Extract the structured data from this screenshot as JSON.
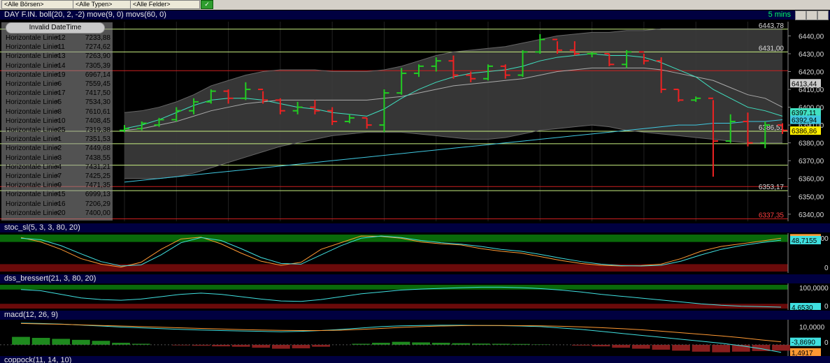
{
  "toolbar": {
    "combo1": "<Alle Börsen>",
    "combo2": "<Alle Typen>",
    "combo3": "<Alle Felder>",
    "go": "✓"
  },
  "main_header": {
    "title": "DAY F.IN. boll(20, 2, -2) move(9, 0) movs(60, 0)",
    "timeframe": "5 mins"
  },
  "legend": {
    "invalid": "Invalid DateTime",
    "rows": [
      {
        "name": "Horizontale Linie12",
        "value": "7233,88"
      },
      {
        "name": "Horizontale Linie11",
        "value": "7274,62"
      },
      {
        "name": "Horizontale Linie13",
        "value": "7263,90"
      },
      {
        "name": "Horizontale Linie14",
        "value": "7305,39"
      },
      {
        "name": "Horizontale Linie19",
        "value": "6967,14"
      },
      {
        "name": "Horizontale Linie6",
        "value": "7559,45"
      },
      {
        "name": "Horizontale Linie17",
        "value": "7417,50"
      },
      {
        "name": "Horizontale Linie5",
        "value": "7534,30"
      },
      {
        "name": "Horizontale Linie8",
        "value": "7610,61"
      },
      {
        "name": "Horizontale Linie10",
        "value": "7408,45"
      },
      {
        "name": "Horizontale Linie25",
        "value": "7319,38"
      },
      {
        "name": "Horizontale Linie1",
        "value": "7351,53"
      },
      {
        "name": "Horizontale Linie2",
        "value": "7449,68"
      },
      {
        "name": "Horizontale Linie3",
        "value": "7438,55"
      },
      {
        "name": "Horizontale Linie4",
        "value": "7431,21"
      },
      {
        "name": "Horizontale Linie7",
        "value": "7425,25"
      },
      {
        "name": "Horizontale Linie9",
        "value": "7471,35"
      },
      {
        "name": "Horizontale Linie15",
        "value": "6999,13"
      },
      {
        "name": "Horizontale Linie16",
        "value": "7206,29"
      },
      {
        "name": "Horizontale Linie20",
        "value": "7400,00"
      }
    ]
  },
  "panels": {
    "stoc": {
      "title": "stoc_sl(5, 3, 3, 80, 20)"
    },
    "dss": {
      "title": "dss_bressert(21, 3, 80, 20)"
    },
    "macd": {
      "title": "macd(12, 26, 9)"
    },
    "coppock": {
      "title": "coppock(11, 14, 10)"
    }
  },
  "chart_data": [
    {
      "type": "bar",
      "title": "DAY F.IN. boll(20, 2, -2) move(9, 0) movs(60, 0)",
      "ylim": [
        6336,
        6448
      ],
      "y_ticks": [
        6340,
        6350,
        6360,
        6370,
        6380,
        6390,
        6400,
        6410,
        6420,
        6430,
        6440
      ],
      "y_tick_labels": [
        "6340,00",
        "6350,00",
        "6360,00",
        "6370,00",
        "6380,00",
        "6390,00",
        "6400,00",
        "6410,00",
        "6420,00",
        "6430,00",
        "6440,00"
      ],
      "colors": {
        "up": "#22cc22",
        "down": "#ee2222",
        "ma_fast": "#40e0c0",
        "ma_slow": "#aaaaaa",
        "ma_long": "#40c8e0",
        "band": "#3c3c3c",
        "hline": "#c8f080",
        "hline_red": "#cc2020"
      },
      "ohlc": [
        {
          "o": 6387,
          "h": 6390,
          "l": 6386,
          "c": 6388
        },
        {
          "o": 6388,
          "h": 6392,
          "l": 6387,
          "c": 6391
        },
        {
          "o": 6390,
          "h": 6394,
          "l": 6389,
          "c": 6393
        },
        {
          "o": 6393,
          "h": 6400,
          "l": 6392,
          "c": 6398
        },
        {
          "o": 6398,
          "h": 6405,
          "l": 6396,
          "c": 6403
        },
        {
          "o": 6403,
          "h": 6410,
          "l": 6402,
          "c": 6409
        },
        {
          "o": 6409,
          "h": 6410,
          "l": 6402,
          "c": 6405
        },
        {
          "o": 6405,
          "h": 6414,
          "l": 6404,
          "c": 6410
        },
        {
          "o": 6410,
          "h": 6409,
          "l": 6402,
          "c": 6404
        },
        {
          "o": 6404,
          "h": 6405,
          "l": 6396,
          "c": 6398
        },
        {
          "o": 6398,
          "h": 6403,
          "l": 6396,
          "c": 6400
        },
        {
          "o": 6400,
          "h": 6404,
          "l": 6396,
          "c": 6398
        },
        {
          "o": 6398,
          "h": 6400,
          "l": 6390,
          "c": 6392
        },
        {
          "o": 6392,
          "h": 6396,
          "l": 6391,
          "c": 6394
        },
        {
          "o": 6394,
          "h": 6394,
          "l": 6388,
          "c": 6390
        },
        {
          "o": 6390,
          "h": 6410,
          "l": 6386,
          "c": 6408
        },
        {
          "o": 6408,
          "h": 6422,
          "l": 6407,
          "c": 6419
        },
        {
          "o": 6419,
          "h": 6424,
          "l": 6417,
          "c": 6423
        },
        {
          "o": 6423,
          "h": 6428,
          "l": 6420,
          "c": 6426
        },
        {
          "o": 6426,
          "h": 6429,
          "l": 6416,
          "c": 6418
        },
        {
          "o": 6418,
          "h": 6420,
          "l": 6414,
          "c": 6416
        },
        {
          "o": 6416,
          "h": 6424,
          "l": 6415,
          "c": 6423
        },
        {
          "o": 6423,
          "h": 6424,
          "l": 6416,
          "c": 6418
        },
        {
          "o": 6418,
          "h": 6432,
          "l": 6417,
          "c": 6431
        },
        {
          "o": 6431,
          "h": 6441,
          "l": 6430,
          "c": 6438
        },
        {
          "o": 6438,
          "h": 6437,
          "l": 6430,
          "c": 6432
        },
        {
          "o": 6432,
          "h": 6437,
          "l": 6429,
          "c": 6430
        },
        {
          "o": 6430,
          "h": 6431,
          "l": 6428,
          "c": 6430
        },
        {
          "o": 6430,
          "h": 6430,
          "l": 6423,
          "c": 6424
        },
        {
          "o": 6424,
          "h": 6432,
          "l": 6422,
          "c": 6431
        },
        {
          "o": 6431,
          "h": 6430,
          "l": 6424,
          "c": 6426
        },
        {
          "o": 6426,
          "h": 6428,
          "l": 6408,
          "c": 6410
        },
        {
          "o": 6410,
          "h": 6410,
          "l": 6403,
          "c": 6404
        },
        {
          "o": 6404,
          "h": 6406,
          "l": 6403,
          "c": 6405
        },
        {
          "o": 6405,
          "h": 6404,
          "l": 6361,
          "c": 6381
        },
        {
          "o": 6381,
          "h": 6396,
          "l": 6380,
          "c": 6392
        },
        {
          "o": 6392,
          "h": 6397,
          "l": 6378,
          "c": 6380
        },
        {
          "o": 6380,
          "h": 6392,
          "l": 6377,
          "c": 6390
        },
        {
          "o": 6390,
          "h": 6391,
          "l": 6385,
          "c": 6387
        }
      ],
      "series": [
        {
          "name": "boll upper",
          "values": [
            6397,
            6398,
            6400,
            6403,
            6407,
            6412,
            6415,
            6418,
            6420,
            6421,
            6421,
            6421,
            6420,
            6420,
            6420,
            6421,
            6423,
            6426,
            6429,
            6431,
            6432,
            6433,
            6434,
            6436,
            6438,
            6440,
            6441,
            6442,
            6442,
            6443,
            6443,
            6444,
            6444,
            6444,
            6444,
            6444,
            6444,
            6444,
            6444
          ]
        },
        {
          "name": "boll middle",
          "values": [
            6387,
            6388,
            6390,
            6392,
            6395,
            6398,
            6400,
            6402,
            6403,
            6404,
            6404,
            6404,
            6404,
            6404,
            6404,
            6405,
            6406,
            6408,
            6410,
            6412,
            6413,
            6414,
            6415,
            6416,
            6418,
            6420,
            6421,
            6422,
            6422,
            6422,
            6422,
            6421,
            6419,
            6417,
            6415,
            6411,
            6407,
            6405,
            6400
          ]
        },
        {
          "name": "boll lower",
          "values": [
            6360,
            6360,
            6360,
            6361,
            6363,
            6366,
            6369,
            6372,
            6375,
            6378,
            6380,
            6382,
            6384,
            6385,
            6386,
            6386,
            6386,
            6385,
            6384,
            6383,
            6382,
            6382,
            6383,
            6385,
            6387,
            6388,
            6389,
            6390,
            6389,
            6387,
            6386,
            6385,
            6384,
            6383,
            6382,
            6381,
            6380,
            6380,
            6380
          ]
        },
        {
          "name": "move",
          "values": [
            6388,
            6390,
            6393,
            6397,
            6401,
            6404,
            6405,
            6405,
            6404,
            6402,
            6400,
            6399,
            6397,
            6396,
            6395,
            6399,
            6405,
            6410,
            6414,
            6417,
            6419,
            6420,
            6421,
            6423,
            6426,
            6428,
            6429,
            6430,
            6429,
            6429,
            6428,
            6425,
            6421,
            6417,
            6410,
            6405,
            6400,
            6398,
            6395
          ]
        },
        {
          "name": "movs",
          "values": [
            6358,
            6359,
            6360,
            6361,
            6362,
            6363,
            6364,
            6365,
            6366,
            6367,
            6368,
            6369,
            6370,
            6371,
            6372,
            6373,
            6374,
            6375,
            6376,
            6377,
            6378,
            6379,
            6380,
            6381,
            6382,
            6383,
            6384,
            6385,
            6386,
            6387,
            6388,
            6389,
            6390,
            6390,
            6391,
            6391,
            6392,
            6392,
            6393
          ]
        }
      ],
      "horizontal_lines": [
        {
          "value": 6443.78,
          "label": "6443,78",
          "color": "#c8f080"
        },
        {
          "value": 6431.0,
          "label": "6431,00",
          "color": "#c8f080"
        },
        {
          "value": 6420.5,
          "label": "",
          "color": "#cc2020"
        },
        {
          "value": 6386.51,
          "label": "6386,51",
          "color": "#c8f080"
        },
        {
          "value": 6379.5,
          "label": "",
          "color": "#c8f080"
        },
        {
          "value": 6367.5,
          "label": "",
          "color": "#c8f080"
        },
        {
          "value": 6355.5,
          "label": "",
          "color": "#cc2020"
        },
        {
          "value": 6353.17,
          "label": "6353,17",
          "color": "#c8f080"
        },
        {
          "value": 6337.35,
          "label": "6337,35",
          "color": "#cc2020"
        }
      ],
      "price_tags": [
        {
          "value": 6413.44,
          "label": "6413,44",
          "bg": "#cccccc",
          "fg": "#000000"
        },
        {
          "value": 6397.11,
          "label": "6397,11",
          "bg": "#40e0c0",
          "fg": "#000000"
        },
        {
          "value": 6392.94,
          "label": "6392,94",
          "bg": "#40c8e0",
          "fg": "#000000"
        },
        {
          "value": 6386.86,
          "label": "6386,86",
          "bg": "#ffee00",
          "fg": "#000000"
        }
      ]
    },
    {
      "type": "line",
      "title": "stoc_sl(5, 3, 3, 80, 20)",
      "ylim": [
        0,
        100
      ],
      "y_tick_labels": [
        "100,0000",
        "0"
      ],
      "series": [
        {
          "name": "k",
          "color": "#ff9933",
          "values": [
            92,
            80,
            60,
            35,
            20,
            12,
            25,
            60,
            88,
            93,
            75,
            50,
            28,
            17,
            25,
            60,
            78,
            96,
            95,
            90,
            80,
            75,
            72,
            62,
            55,
            50,
            40,
            30,
            22,
            17,
            15,
            16,
            20,
            35,
            55,
            68,
            75,
            82,
            90
          ]
        },
        {
          "name": "d",
          "color": "#40e0e0",
          "values": [
            90,
            86,
            70,
            48,
            27,
            15,
            18,
            45,
            78,
            92,
            84,
            62,
            38,
            22,
            20,
            45,
            70,
            90,
            96,
            92,
            84,
            78,
            74,
            68,
            60,
            55,
            46,
            36,
            27,
            20,
            16,
            15,
            17,
            28,
            45,
            60,
            70,
            78,
            85
          ]
        }
      ],
      "tags": [
        {
          "label": "58,3333",
          "color": "#ff9933"
        },
        {
          "label": "48,7155",
          "color": "#40e0e0"
        }
      ]
    },
    {
      "type": "line",
      "title": "dss_bressert(21, 3, 80, 20)",
      "ylim": [
        0,
        100
      ],
      "y_tick_labels": [
        "100,0000",
        "0"
      ],
      "series": [
        {
          "name": "dss",
          "color": "#40e0e0",
          "values": [
            80,
            75,
            60,
            45,
            38,
            35,
            40,
            50,
            60,
            65,
            60,
            50,
            40,
            32,
            30,
            38,
            50,
            62,
            70,
            78,
            82,
            85,
            88,
            90,
            90,
            88,
            84,
            78,
            70,
            60,
            52,
            44,
            36,
            28,
            20,
            14,
            10,
            8,
            6
          ]
        }
      ],
      "tags": [
        {
          "label": "4,6530",
          "color": "#40e0e0"
        }
      ]
    },
    {
      "type": "bar",
      "title": "macd(12, 26, 9)",
      "ylim": [
        -5,
        12
      ],
      "y_tick_labels": [
        "10,0000",
        "0"
      ],
      "histogram": [
        4,
        3.5,
        3,
        2.5,
        2,
        1,
        0.5,
        0,
        -0.3,
        -0.5,
        -0.8,
        -1,
        -1.5,
        -2,
        -1.8,
        -1,
        0,
        0.5,
        1,
        1.5,
        1.2,
        1,
        0.8,
        0.6,
        0.5,
        0.4,
        0.2,
        0,
        -0.4,
        -0.8,
        -1.5,
        -2,
        -2.5,
        -3,
        -3.5,
        -3.8,
        -3.5,
        -3.2,
        -3
      ],
      "series": [
        {
          "name": "macd",
          "color": "#40e0e0",
          "values": [
            11,
            10.8,
            10.5,
            10,
            9.5,
            9,
            8.6,
            8.2,
            7.8,
            7.5,
            7.2,
            7,
            6.8,
            6.6,
            6.8,
            7.2,
            7.8,
            8.5,
            9.2,
            9.6,
            9.8,
            9.9,
            9.9,
            9.8,
            9.7,
            9.5,
            9.2,
            8.5,
            7.8,
            6.8,
            5.8,
            4.8,
            3.8,
            2.8,
            1.8,
            0.8,
            -0.5,
            -2,
            -3.86
          ]
        },
        {
          "name": "signal",
          "color": "#ff9933",
          "values": [
            10.8,
            10.6,
            10.4,
            10.1,
            9.8,
            9.5,
            9.2,
            8.9,
            8.6,
            8.3,
            8,
            7.7,
            7.5,
            7.3,
            7.2,
            7.2,
            7.4,
            7.8,
            8.3,
            8.8,
            9.2,
            9.5,
            9.7,
            9.8,
            9.8,
            9.7,
            9.6,
            9.4,
            9.1,
            8.7,
            8.2,
            7.6,
            6.9,
            6.1,
            5.3,
            4.5,
            3.6,
            2.5,
            1.49
          ]
        }
      ],
      "tags": [
        {
          "label": "1,4917",
          "color": "#ff9933"
        },
        {
          "label": "-3,8690",
          "color": "#40e0e0"
        }
      ]
    }
  ]
}
